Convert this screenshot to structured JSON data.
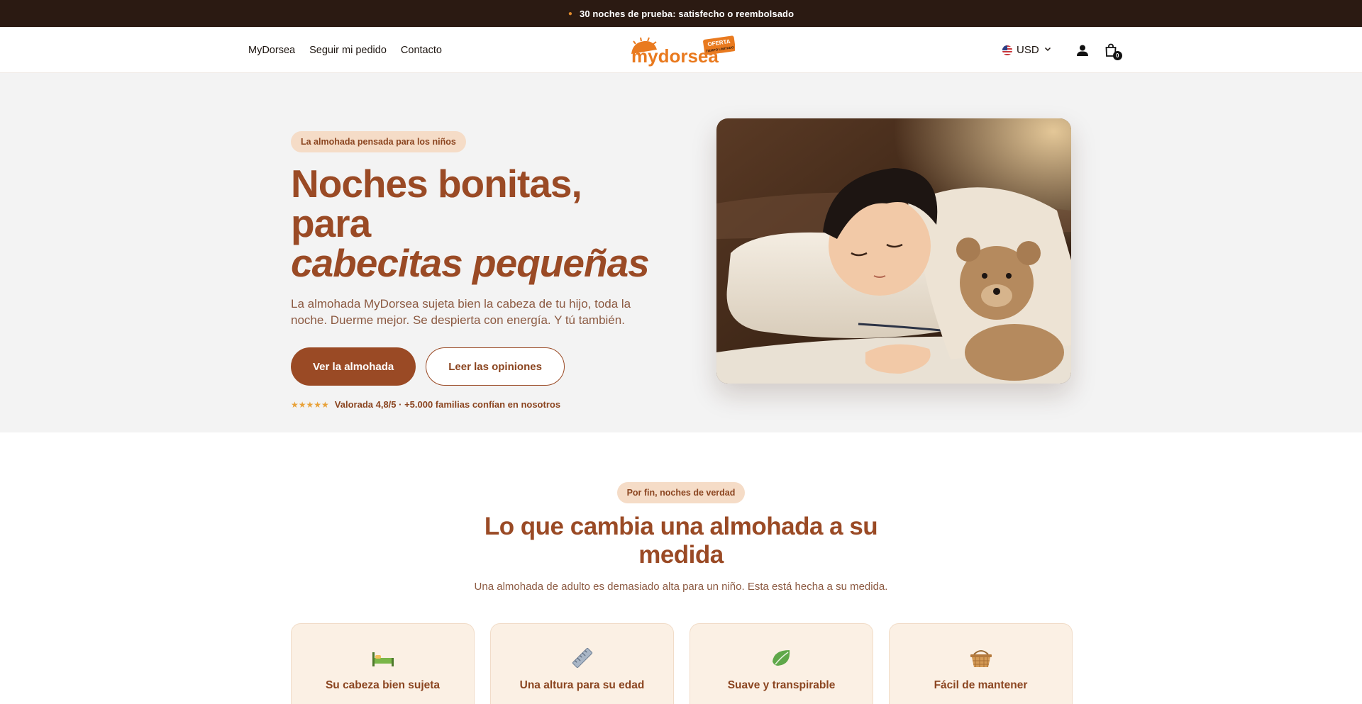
{
  "announcement": {
    "text": "30 noches de prueba: satisfecho o reembolsado"
  },
  "nav": {
    "items": [
      "MyDorsea",
      "Seguir mi pedido",
      "Contacto"
    ]
  },
  "logo": {
    "text": "mydorsea",
    "badge_main": "OFERTA",
    "badge_sub": "TIEMPO LIMITADO"
  },
  "header": {
    "currency": "USD",
    "cart_count": "0",
    "icons": [
      "flag-us-icon",
      "chevron-down-icon",
      "account-icon",
      "shopping-bag-icon"
    ]
  },
  "hero": {
    "badge": "La almohada pensada para los niños",
    "title_line1": "Noches bonitas, para",
    "title_line2": "cabecitas pequeñas",
    "subtitle": "La almohada MyDorsea sujeta bien la cabeza de tu hijo, toda la noche. Duerme mejor. Se despierta con energía. Y tú también.",
    "cta_primary": "Ver la almohada",
    "cta_secondary": "Leer las opiniones",
    "stars": "★★★★★",
    "rating_text": "Valorada 4,8/5 · +5.000 familias confían en nosotros"
  },
  "benefits": {
    "badge": "Por fin, noches de verdad",
    "title": "Lo que cambia una almohada a su medida",
    "subtitle": "Una almohada de adulto es demasiado alta para un niño. Esta está hecha a su medida.",
    "cards": [
      {
        "icon": "bed-icon",
        "title": "Su cabeza bien sujeta"
      },
      {
        "icon": "ruler-icon",
        "title": "Una altura para su edad"
      },
      {
        "icon": "leaf-icon",
        "title": "Suave y transpirable"
      },
      {
        "icon": "basket-icon",
        "title": "Fácil de mantener"
      }
    ]
  },
  "colors": {
    "brand": "#9a4a25",
    "announce_bg": "#2b1a12",
    "pill_bg": "#f5dcc7",
    "card_bg": "#fbf0e4",
    "logo_orange": "#e97a1f"
  }
}
